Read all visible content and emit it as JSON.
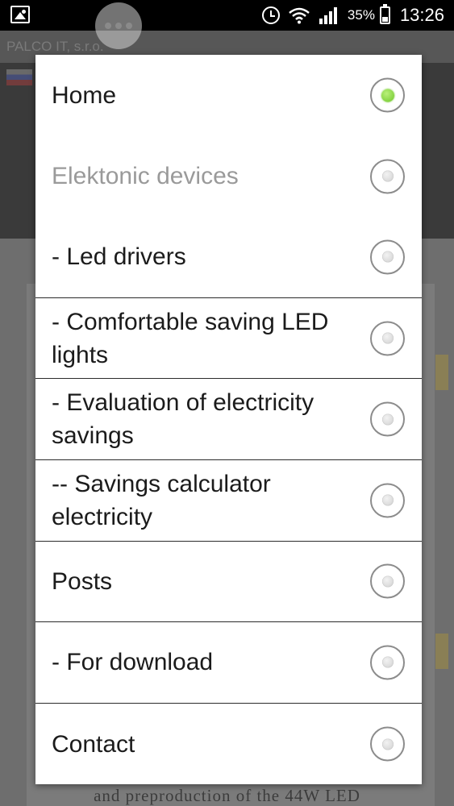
{
  "status_bar": {
    "battery_percent": "35%",
    "time": "13:26"
  },
  "background_app": {
    "title": "PALCO IT, s.r.o.",
    "content_text": "and preproduction of the 44W LED"
  },
  "dialog": {
    "options": [
      {
        "label": "Home",
        "selected": true,
        "enabled": true
      },
      {
        "label": "Elektonic devices",
        "selected": false,
        "enabled": false
      },
      {
        "label": "- Led drivers",
        "selected": false,
        "enabled": true
      },
      {
        "label": "- Comfortable saving LED lights",
        "selected": false,
        "enabled": true
      },
      {
        "label": "- Evaluation of electricity savings",
        "selected": false,
        "enabled": true
      },
      {
        "label": "-- Savings calculator electricity",
        "selected": false,
        "enabled": true
      },
      {
        "label": "Posts",
        "selected": false,
        "enabled": true
      },
      {
        "label": "- For download",
        "selected": false,
        "enabled": true
      },
      {
        "label": "Contact",
        "selected": false,
        "enabled": true
      }
    ]
  },
  "colors": {
    "radio_selected": "#6fc72a",
    "disabled_text": "#9a9a9a"
  }
}
